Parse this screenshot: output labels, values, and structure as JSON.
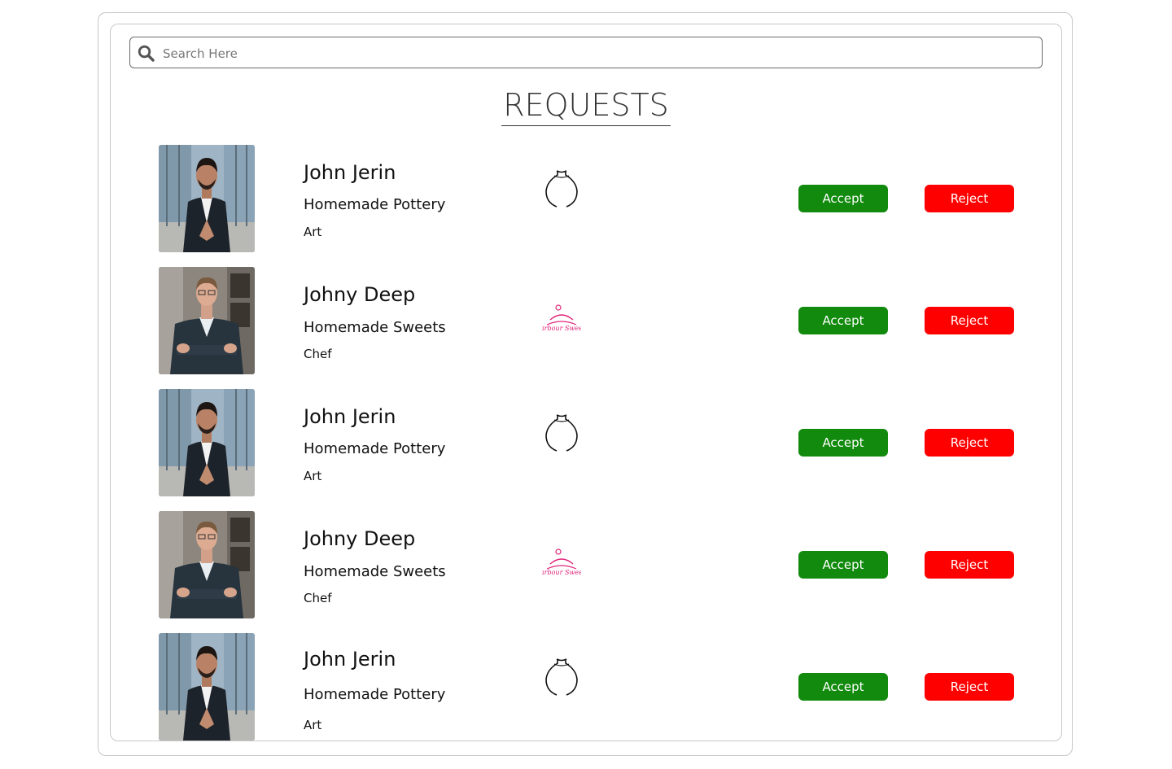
{
  "search": {
    "placeholder": "Search Here",
    "value": ""
  },
  "page_title": "REQUESTS",
  "colors": {
    "accept": "#118a0d",
    "reject": "#ff0000",
    "border": "#c8c8c8"
  },
  "requests": [
    {
      "name": "John Jerin",
      "business": "Homemade Pottery",
      "category": "Art",
      "logo": "pottery-vase-icon",
      "accept_label": "Accept",
      "reject_label": "Reject"
    },
    {
      "name": "Johny Deep",
      "business": "Homemade Sweets",
      "category": "Chef",
      "logo": "harbour-sweets-logo",
      "accept_label": "Accept",
      "reject_label": "Reject"
    },
    {
      "name": "John Jerin",
      "business": "Homemade Pottery",
      "category": "Art",
      "logo": "pottery-vase-icon",
      "accept_label": "Accept",
      "reject_label": "Reject"
    },
    {
      "name": "Johny Deep",
      "business": "Homemade Sweets",
      "category": "Chef",
      "logo": "harbour-sweets-logo",
      "accept_label": "Accept",
      "reject_label": "Reject"
    },
    {
      "name": "John Jerin",
      "business": "Homemade Pottery",
      "category": "Art",
      "logo": "pottery-vase-icon",
      "accept_label": "Accept",
      "reject_label": "Reject"
    }
  ],
  "logo_text": {
    "harbour_sweets": "Harbour Sweets"
  }
}
